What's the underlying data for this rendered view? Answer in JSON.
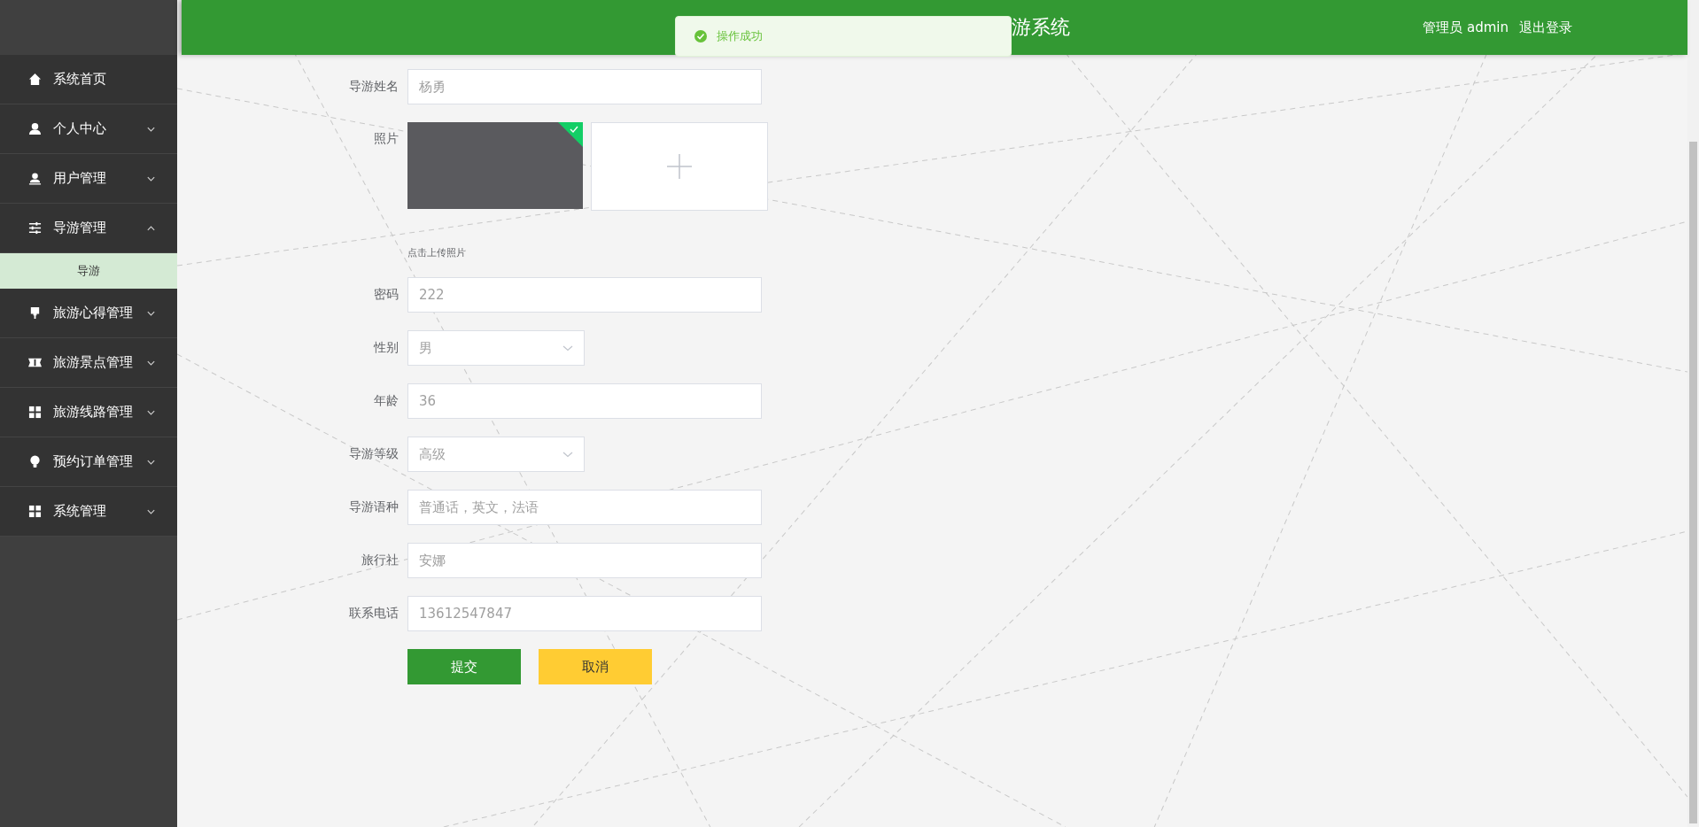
{
  "sidebar": {
    "items": [
      {
        "label": "系统首页"
      },
      {
        "label": "个人中心",
        "expanded": false
      },
      {
        "label": "用户管理",
        "expanded": false
      },
      {
        "label": "导游管理",
        "expanded": true,
        "children": [
          {
            "label": "导游",
            "selected": true
          }
        ]
      },
      {
        "label": "旅游心得管理",
        "expanded": false
      },
      {
        "label": "旅游景点管理",
        "expanded": false
      },
      {
        "label": "旅游线路管理",
        "expanded": false
      },
      {
        "label": "预约订单管理",
        "expanded": false
      },
      {
        "label": "系统管理",
        "expanded": false
      }
    ]
  },
  "header": {
    "title": "游系统",
    "user": "管理员 admin",
    "logout": "退出登录"
  },
  "toast": {
    "message": "操作成功"
  },
  "form": {
    "fields": [
      {
        "kind": "text",
        "label": "导游姓名",
        "value": "杨勇"
      },
      {
        "kind": "upload",
        "label": "照片",
        "hint": "点击上传照片"
      },
      {
        "kind": "text",
        "label": "密码",
        "value": "222"
      },
      {
        "kind": "select",
        "label": "性别",
        "value": "男"
      },
      {
        "kind": "text",
        "label": "年龄",
        "value": "36"
      },
      {
        "kind": "select",
        "label": "导游等级",
        "value": "高级"
      },
      {
        "kind": "text",
        "label": "导游语种",
        "value": "普通话，英文，法语"
      },
      {
        "kind": "text",
        "label": "旅行社",
        "value": "安娜"
      },
      {
        "kind": "text",
        "label": "联系电话",
        "value": "13612547847"
      }
    ],
    "buttons": [
      {
        "kind": "primary",
        "label": "提交"
      },
      {
        "kind": "warning",
        "label": "取消"
      }
    ]
  }
}
